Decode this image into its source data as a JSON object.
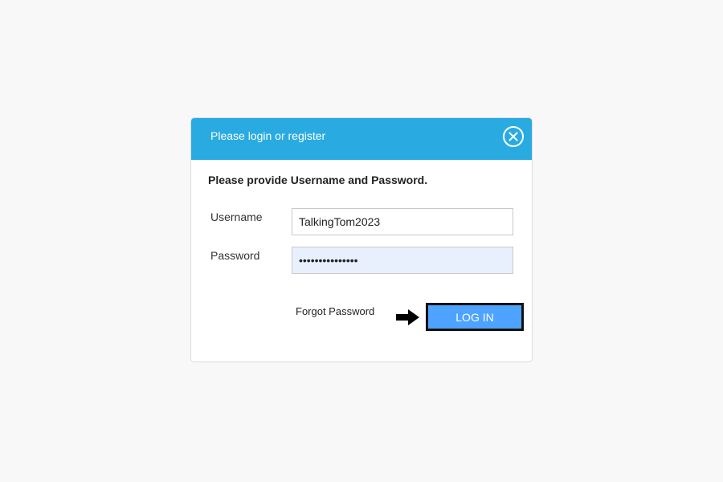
{
  "dialog": {
    "title": "Please login or register",
    "close_icon": "close-circle-icon",
    "instructions": "Please provide Username and Password.",
    "username_label": "Username",
    "username_value": "TalkingTom2023",
    "password_label": "Password",
    "password_value": "•••••••••••••••",
    "forgot_label": "Forgot Password",
    "login_label": "LOG IN",
    "arrow_icon": "arrow-right-icon"
  },
  "colors": {
    "header": "#29abe2",
    "login_button": "#4da3ff",
    "password_autofill_bg": "#e8f0fe"
  }
}
